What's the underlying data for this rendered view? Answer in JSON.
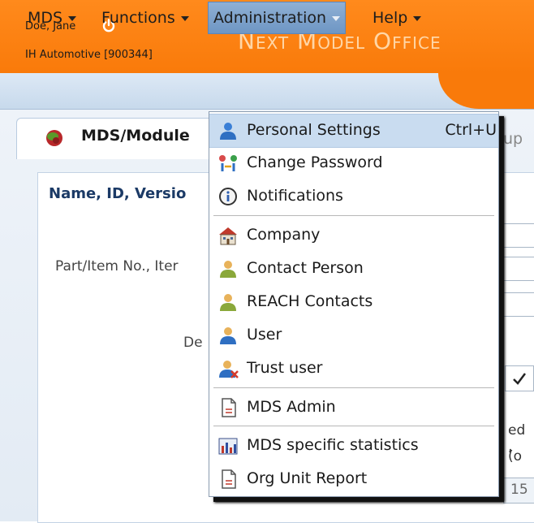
{
  "header": {
    "user_name": "Doe, Jane",
    "company": "IH Automotive [900344]",
    "app_title": "Next Model Office"
  },
  "menubar": {
    "items": [
      {
        "label": "MDS"
      },
      {
        "label": "Functions"
      },
      {
        "label": "Administration"
      },
      {
        "label": "Help"
      }
    ],
    "active_item": "Administration"
  },
  "tab": {
    "label": "MDS/Module"
  },
  "background": {
    "section_title": "Name, ID, Versio",
    "part_label": "Part/Item No., Iter",
    "de_label": "De",
    "partial_1": "ed ,",
    "partial_2": "(o",
    "partial_3": "15",
    "partial_4": "up"
  },
  "dropdown": {
    "items": [
      {
        "label": "Personal Settings",
        "shortcut": "Ctrl+U",
        "icon": "person-blue-icon",
        "highlighted": true
      },
      {
        "label": "Change Password",
        "icon": "change-password-icon"
      },
      {
        "label": "Notifications",
        "icon": "info-icon"
      },
      {
        "label": "Company",
        "icon": "company-building-icon"
      },
      {
        "label": "Contact Person",
        "icon": "contact-person-icon"
      },
      {
        "label": "REACH Contacts",
        "icon": "reach-contacts-icon"
      },
      {
        "label": "User",
        "icon": "user-icon"
      },
      {
        "label": "Trust user",
        "icon": "trust-user-icon"
      },
      {
        "label": "MDS Admin",
        "icon": "document-icon"
      },
      {
        "label": "MDS specific statistics",
        "icon": "statistics-chart-icon"
      },
      {
        "label": "Org Unit Report",
        "icon": "report-document-icon"
      }
    ]
  },
  "colors": {
    "header_orange": "#f97a0a",
    "menubar_blue": "#c7d9ec",
    "highlight_blue": "#c9dcf0",
    "title_color": "#1b3a66"
  }
}
